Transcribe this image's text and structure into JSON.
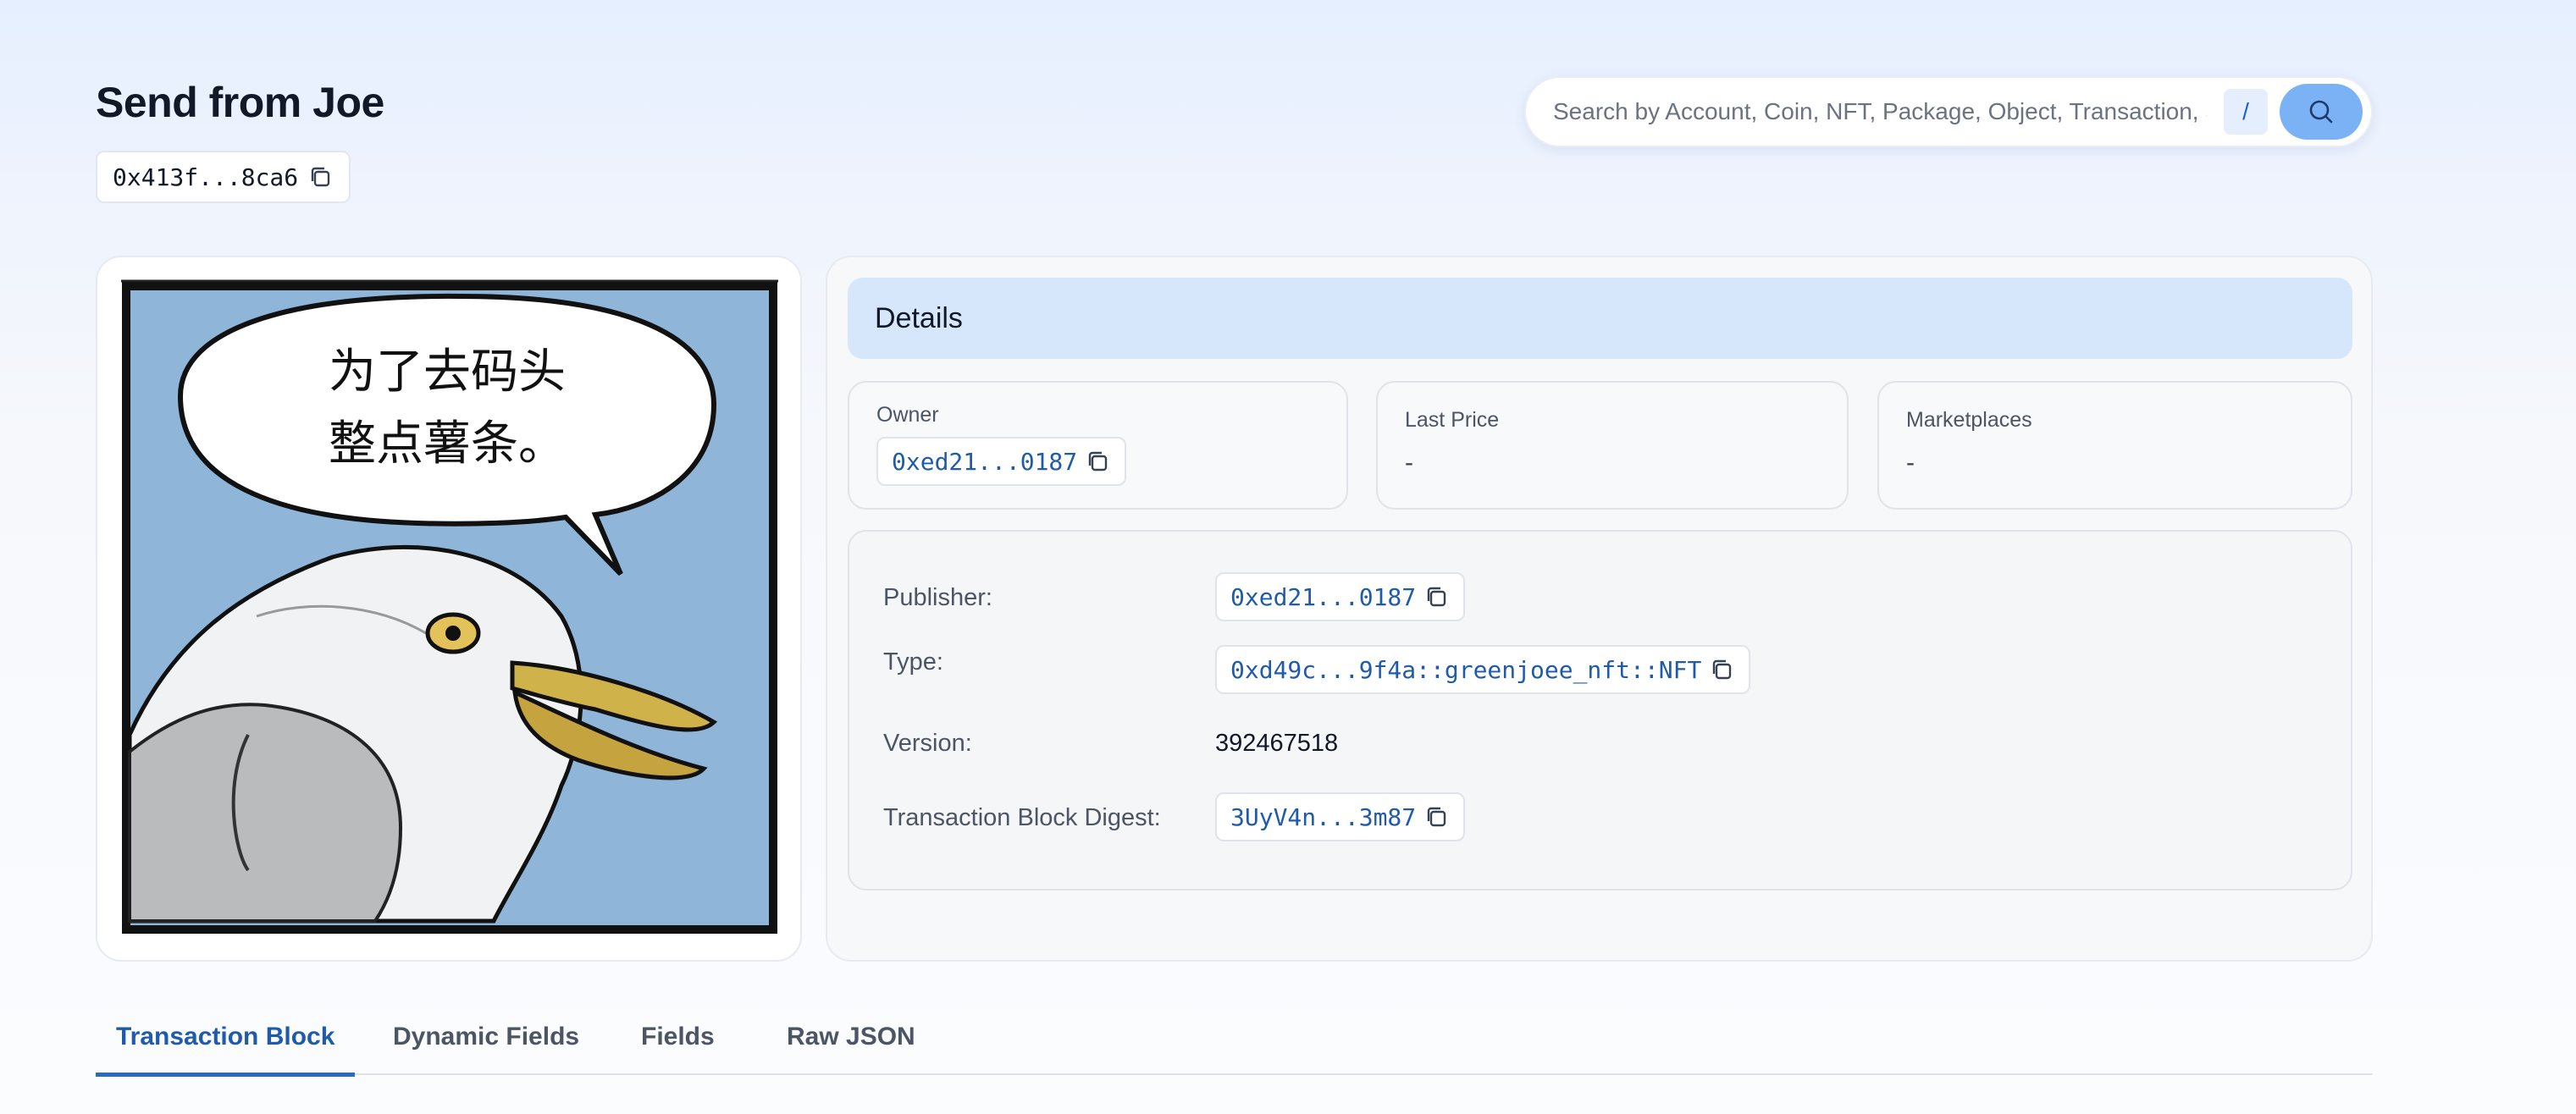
{
  "page": {
    "title": "Send from Joe",
    "object_address": "0x413f...8ca6"
  },
  "search": {
    "placeholder": "Search by Account, Coin, NFT, Package, Object, Transaction, S...",
    "shortcut": "/"
  },
  "image": {
    "speech_line_1": "为了去码头",
    "speech_line_2": "整点薯条。"
  },
  "details": {
    "header": "Details",
    "owner_label": "Owner",
    "owner_value": "0xed21...0187",
    "last_price_label": "Last Price",
    "last_price_value": "-",
    "marketplaces_label": "Marketplaces",
    "marketplaces_value": "-",
    "publisher_label": "Publisher:",
    "publisher_value": "0xed21...0187",
    "type_label": "Type:",
    "type_value": "0xd49c...9f4a::greenjoee_nft::NFT",
    "version_label": "Version:",
    "version_value": "392467518",
    "digest_label": "Transaction Block Digest:",
    "digest_value": "3UyV4n...3m87"
  },
  "tabs": [
    {
      "label": "Transaction Block",
      "active": true
    },
    {
      "label": "Dynamic Fields",
      "active": false
    },
    {
      "label": "Fields",
      "active": false
    },
    {
      "label": "Raw JSON",
      "active": false
    }
  ],
  "colors": {
    "accent": "#1f5aab",
    "details_header_bg": "#d6e7fc",
    "search_button": "#7ab2f5",
    "image_sky": "#8fb6d8"
  },
  "icons": {
    "copy": "copy-icon",
    "search": "search-icon"
  }
}
